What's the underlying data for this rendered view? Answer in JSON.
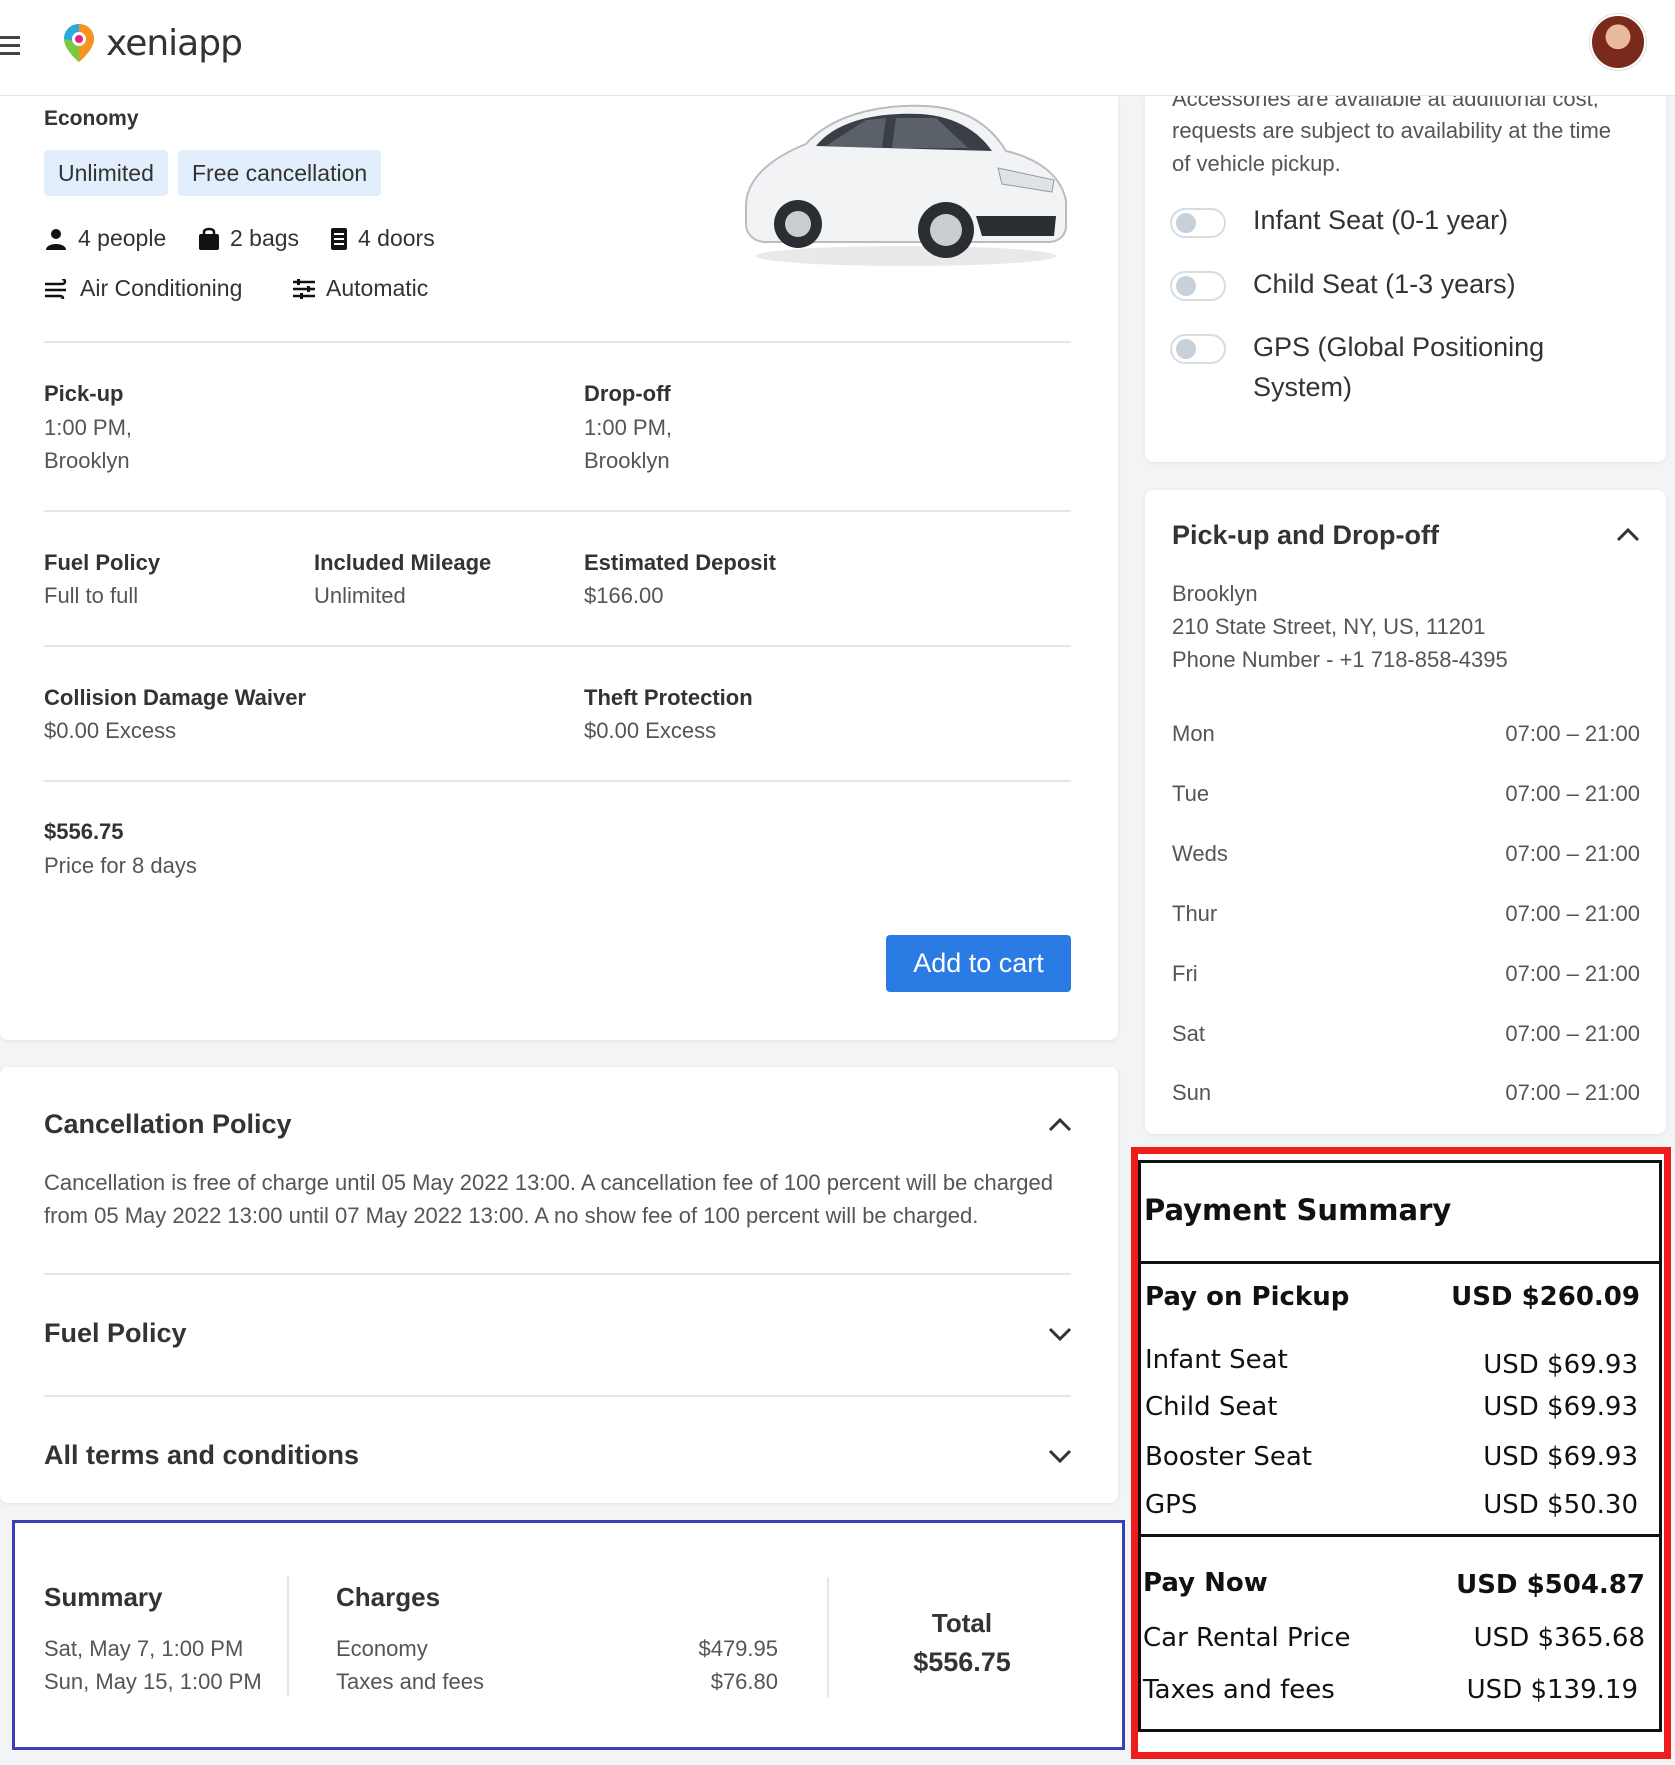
{
  "header": {
    "brand": "xeniapp"
  },
  "vehicle": {
    "category": "Economy",
    "chips": [
      "Unlimited",
      "Free cancellation"
    ],
    "features": {
      "people": "4 people",
      "bags": "2 bags",
      "doors": "4 doors",
      "ac": "Air Conditioning",
      "transmission": "Automatic"
    }
  },
  "pickup": {
    "label": "Pick-up",
    "time": "1:00 PM,",
    "place": "Brooklyn"
  },
  "dropoff": {
    "label": "Drop-off",
    "time": "1:00 PM,",
    "place": "Brooklyn"
  },
  "details": {
    "fuel_label": "Fuel Policy",
    "fuel_value": "Full to full",
    "mileage_label": "Included Mileage",
    "mileage_value": "Unlimited",
    "deposit_label": "Estimated Deposit",
    "deposit_value": "$166.00",
    "cdw_label": "Collision Damage Waiver",
    "cdw_value": "$0.00 Excess",
    "theft_label": "Theft Protection",
    "theft_value": "$0.00 Excess"
  },
  "price": {
    "amount": "$556.75",
    "caption": "Price for 8 days",
    "add_to_cart": "Add to cart"
  },
  "policies": {
    "cancellation_title": "Cancellation Policy",
    "cancellation_line1": "Cancellation is free of charge until 05 May 2022 13:00. A cancellation fee of 100 percent will be charged",
    "cancellation_line2": "from 05 May 2022 13:00 until 07 May 2022 13:00. A no show fee of 100 percent will be charged.",
    "fuel_title": "Fuel Policy",
    "terms_title": "All terms and conditions"
  },
  "accessories": {
    "intro_line0": "Accessories are available at additional cost,",
    "intro_line1": "requests are subject to availability at the time",
    "intro_line2": "of vehicle pickup.",
    "items": [
      "Infant Seat (0-1 year)",
      "Child Seat (1-3 years)",
      "GPS (Global Positioning",
      "System)"
    ]
  },
  "location": {
    "title": "Pick-up and Drop-off",
    "name": "Brooklyn",
    "address": "210 State Street, NY, US, 11201",
    "phone": "Phone Number - +1 718-858-4395",
    "hours": [
      {
        "day": "Mon",
        "time": "07:00 – 21:00"
      },
      {
        "day": "Tue",
        "time": "07:00 – 21:00"
      },
      {
        "day": "Weds",
        "time": "07:00 – 21:00"
      },
      {
        "day": "Thur",
        "time": "07:00 – 21:00"
      },
      {
        "day": "Fri",
        "time": "07:00 – 21:00"
      },
      {
        "day": "Sat",
        "time": "07:00 – 21:00"
      },
      {
        "day": "Sun",
        "time": "07:00 – 21:00"
      }
    ]
  },
  "summary": {
    "title": "Summary",
    "pickup_date": "Sat, May 7, 1:00 PM",
    "dropoff_date": "Sun, May 15, 1:00 PM",
    "charges_title": "Charges",
    "charge1_label": "Economy",
    "charge1_value": "$479.95",
    "charge2_label": "Taxes and fees",
    "charge2_value": "$76.80",
    "total_label": "Total",
    "total_value": "$556.75"
  },
  "payment_summary": {
    "title": "Payment Summary",
    "pay_on_pickup_label": "Pay on Pickup",
    "pay_on_pickup_value": "USD $260.09",
    "infant_label": "Infant Seat",
    "infant_value": "USD $69.93",
    "child_label": "Child Seat",
    "child_value": "USD $69.93",
    "booster_label": "Booster Seat",
    "booster_value": "USD $69.93",
    "gps_label": "GPS",
    "gps_value": "USD $50.30",
    "pay_now_label": "Pay Now",
    "pay_now_value": "USD $504.87",
    "car_label": "Car Rental Price",
    "car_value": "USD $365.68",
    "taxes_label": "Taxes and fees",
    "taxes_value": "USD $139.19"
  },
  "colors": {
    "accent": "#2a7be4",
    "chip_bg": "#e3eefc",
    "highlight_red": "#ee1c1c",
    "highlight_blue": "#3a3fb5"
  }
}
